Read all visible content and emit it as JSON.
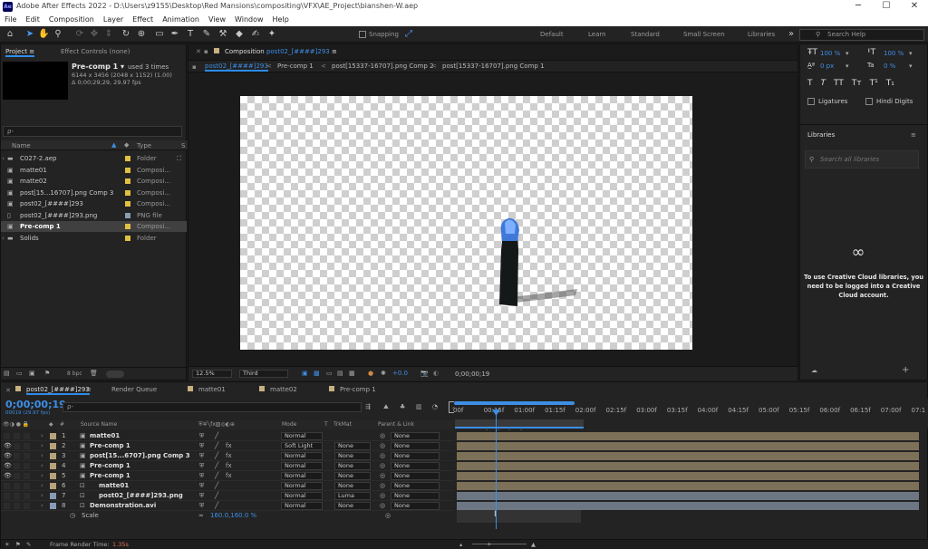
{
  "titlebar": {
    "title": "Adobe After Effects 2022 - D:\\Users\\z9155\\Desktop\\Red Mansions\\compositing\\VFX\\AE_Project\\bianshen-W.aep",
    "app_icon": "Ae",
    "minimize": "─",
    "maximize": "☐",
    "close": "✕"
  },
  "menu": [
    "File",
    "Edit",
    "Composition",
    "Layer",
    "Effect",
    "Animation",
    "View",
    "Window",
    "Help"
  ],
  "toolbar": {
    "snapping": "Snapping",
    "workspaces": [
      "Default",
      "Learn",
      "Standard",
      "Small Screen",
      "Libraries"
    ],
    "search_placeholder": "Search Help"
  },
  "project": {
    "tab": "Project",
    "tab_menu": "≡",
    "effect_tab": "Effect Controls (none)",
    "comp_name": "Pre-comp 1 ▾",
    "used": "used 3 times",
    "dims": "6144 x 3456  (2048 x 1152) (1.00)",
    "duration": "Δ 0;00;29;29, 29.97 fps",
    "search_placeholder": "ρ‑",
    "col_name": "Name",
    "col_type": "Type",
    "col_s": "S",
    "items": [
      {
        "name": "C027-2.aep",
        "type": "Folder",
        "color": "#e0c042",
        "icon": "folder"
      },
      {
        "name": "matte01",
        "type": "Composi...",
        "color": "#e0c042",
        "icon": "comp"
      },
      {
        "name": "matte02",
        "type": "Composi...",
        "color": "#e0c042",
        "icon": "comp"
      },
      {
        "name": "post[15...16707].png Comp 3",
        "type": "Composi...",
        "color": "#e0c042",
        "icon": "comp"
      },
      {
        "name": "post02_[####]293",
        "type": "Composi...",
        "color": "#e0c042",
        "icon": "comp"
      },
      {
        "name": "post02_[####]293.png",
        "type": "PNG file",
        "color": "#8a9bb5",
        "icon": "file"
      },
      {
        "name": "Pre-comp 1",
        "type": "Composi...",
        "color": "#e0c042",
        "icon": "comp"
      },
      {
        "name": "Solids",
        "type": "Folder",
        "color": "#e0c042",
        "icon": "folder"
      }
    ],
    "bpc": "8 bpc"
  },
  "composition": {
    "panel_label": "Composition",
    "panel_name": "post02_[####]293",
    "panel_menu": "≡",
    "breadcrumbs": [
      "post02_[####]293",
      "Pre-comp 1",
      "post[15337-16707].png Comp 2",
      "post[15337-16707].png Comp 1"
    ],
    "zoom": "12.5%",
    "resolution": "Third",
    "exposure": "+0.0",
    "timecode": "0;00;00;19"
  },
  "character": {
    "size": "100 %",
    "tracking": "0 px",
    "vscale": "100 %",
    "baseline": "0 %",
    "style_buttons": [
      "T",
      "T",
      "TT",
      "Tт",
      "T¹",
      "T₁"
    ],
    "ligatures": "Ligatures",
    "hindi": "Hindi Digits"
  },
  "libraries": {
    "title": "Libraries",
    "menu": "≡",
    "search_placeholder": "Search all libraries",
    "message": "To use Creative Cloud libraries, you need to be logged into a Creative Cloud account."
  },
  "timeline": {
    "tabs": [
      "post02_[####]293",
      "Render Queue",
      "matte01",
      "matte02",
      "Pre-comp 1"
    ],
    "time": "0;00;00;19",
    "time_sub": "00019 (29.97 fps)",
    "search_placeholder": "ρ‑",
    "col_source": "Source Name",
    "col_mode": "Mode",
    "col_t": "T",
    "col_trkmat": "TrkMat",
    "col_parent": "Parent & Link",
    "ruler": [
      "00f",
      "00:15f",
      "01:00f",
      "01:15f",
      "02:00f",
      "02:15f",
      "03:00f",
      "03:15f",
      "04:00f",
      "04:15f",
      "05:00f",
      "05:15f",
      "06:00f",
      "06:15f",
      "07:00f",
      "07:1"
    ],
    "layers": [
      {
        "num": "1",
        "name": "matte01",
        "mode": "Normal",
        "trkmat": "",
        "parent": "None",
        "eye": false,
        "color": "#b8a27a",
        "fx": false
      },
      {
        "num": "2",
        "name": "Pre-comp 1",
        "mode": "Soft Light",
        "trkmat": "None",
        "parent": "None",
        "eye": true,
        "color": "#b8a27a",
        "fx": true
      },
      {
        "num": "3",
        "name": "post[15...6707].png Comp 3",
        "mode": "Normal",
        "trkmat": "None",
        "parent": "None",
        "eye": true,
        "color": "#b8a27a",
        "fx": true
      },
      {
        "num": "4",
        "name": "Pre-comp 1",
        "mode": "Normal",
        "trkmat": "None",
        "parent": "None",
        "eye": true,
        "color": "#b8a27a",
        "fx": true
      },
      {
        "num": "5",
        "name": "Pre-comp 1",
        "mode": "Normal",
        "trkmat": "None",
        "parent": "None",
        "eye": true,
        "color": "#b8a27a",
        "fx": true
      },
      {
        "num": "6",
        "name": "matte01",
        "mode": "Normal",
        "trkmat": "None",
        "parent": "None",
        "eye": false,
        "color": "#b8a27a",
        "fx": false
      },
      {
        "num": "7",
        "name": "post02_[####]293.png",
        "mode": "Normal",
        "trkmat": "Luma",
        "parent": "None",
        "eye": false,
        "color": "#8a9bb5",
        "fx": false
      },
      {
        "num": "8",
        "name": "Demonstration.avi",
        "mode": "Normal",
        "trkmat": "None",
        "parent": "None",
        "eye": false,
        "color": "#8a9bb5",
        "fx": false
      }
    ],
    "scale_label": "Scale",
    "scale_value": "160.0,160.0 %",
    "render_label": "Frame Render Time:",
    "render_value": "1.35s"
  }
}
